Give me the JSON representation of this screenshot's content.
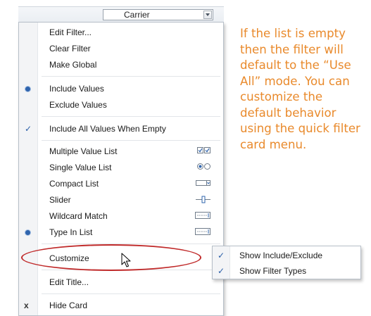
{
  "card": {
    "field_select": {
      "value": "Carrier",
      "icon": "chevron-down-icon"
    }
  },
  "menu": {
    "items": [
      {
        "label": "Edit Filter..."
      },
      {
        "label": "Clear Filter"
      },
      {
        "label": "Make Global"
      },
      {
        "label": "Include Values",
        "mark": "radio-selected"
      },
      {
        "label": "Exclude Values"
      },
      {
        "label": "Include All Values When Empty",
        "mark": "checkmark",
        "mark_glyph": "✓"
      },
      {
        "label": "Multiple Value List",
        "icon": "multiple-value-list-icon"
      },
      {
        "label": "Single Value List",
        "icon": "single-value-list-icon"
      },
      {
        "label": "Compact List",
        "icon": "compact-list-icon"
      },
      {
        "label": "Slider",
        "icon": "slider-icon"
      },
      {
        "label": "Wildcard Match",
        "icon": "wildcard-match-icon"
      },
      {
        "label": "Type In List",
        "mark": "radio-selected",
        "icon": "type-in-list-icon"
      },
      {
        "label": "Customize",
        "has_submenu": true,
        "highlighted": true
      },
      {
        "label": "Edit Title..."
      },
      {
        "label": "Hide Card",
        "mark": "x",
        "mark_glyph": "x"
      }
    ]
  },
  "submenu": {
    "items": [
      {
        "label": "Show Include/Exclude",
        "mark": "checkmark",
        "mark_glyph": "✓"
      },
      {
        "label": "Show Filter Types",
        "mark": "checkmark",
        "mark_glyph": "✓"
      }
    ]
  },
  "annotation": {
    "text": "If the list is empty then the filter will default to the “Use All” mode. You can customize the default behavior using the quick filter card menu."
  },
  "colors": {
    "annotation": "#e98a2c",
    "highlight_ellipse": "#c02a2a",
    "mark_blue": "#2f64ad"
  }
}
